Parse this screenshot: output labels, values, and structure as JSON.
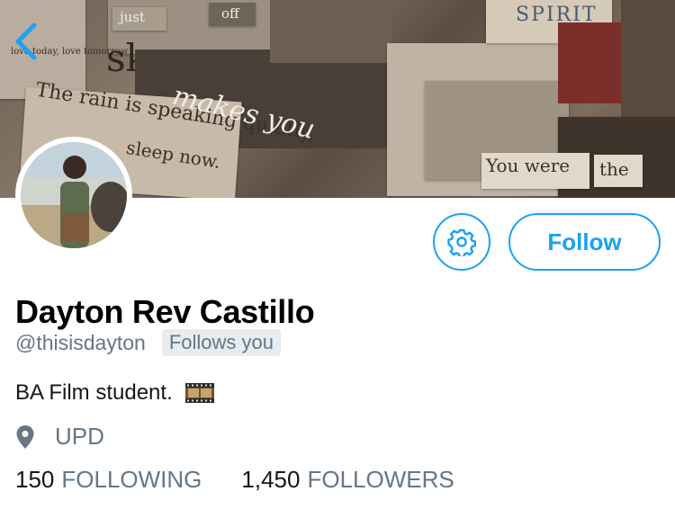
{
  "banner": {
    "collage_texts": {
      "just": "just",
      "off": "off",
      "spirit": "SPIRIT",
      "rain_line1": "The rain is speaking quietly,",
      "sleep": "sleep now.",
      "you_were": "You were",
      "the": "the",
      "makes_you": "makes you",
      "note": "love today, love tomorrow",
      "sk": "sk"
    }
  },
  "nav": {
    "back_icon": "chevron-left-icon"
  },
  "profile": {
    "name": "Dayton Rev Castillo",
    "handle": "@thisisdayton",
    "follows_you": "Follows you",
    "bio": "BA Film student.",
    "bio_emoji": "film-frames-icon",
    "location": "UPD",
    "following_count": "150",
    "following_label": "FOLLOWING",
    "followers_count": "1,450",
    "followers_label": "FOLLOWERS"
  },
  "actions": {
    "follow_label": "Follow",
    "settings_icon": "gear-icon"
  },
  "colors": {
    "accent": "#1da1f2",
    "secondary_text": "#657786",
    "badge_bg": "#e6ecf0"
  }
}
